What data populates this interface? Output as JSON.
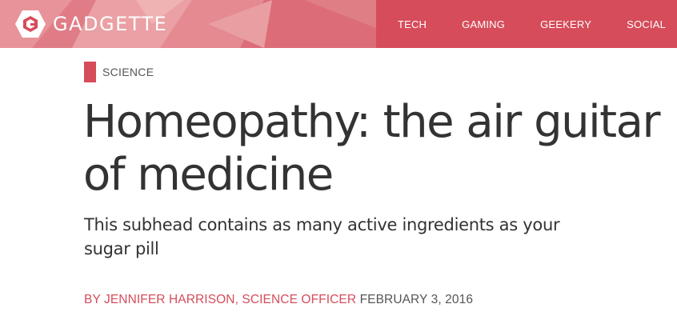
{
  "site": {
    "logo_text": "GADGETTE",
    "logo_icon": "gadgette-hexagon-logo-icon",
    "brand_color": "#d64c5a"
  },
  "nav": {
    "items": [
      {
        "label": "TECH"
      },
      {
        "label": "GAMING"
      },
      {
        "label": "GEEKERY"
      },
      {
        "label": "SOCIAL"
      }
    ]
  },
  "article": {
    "category": "SCIENCE",
    "headline": "Homeopathy: the air guitar of medicine",
    "subhead": "This subhead contains as many active ingredients as your sugar pill",
    "byline_author": "BY JENNIFER HARRISON, SCIENCE OFFICER",
    "byline_date": "FEBRUARY 3, 2016"
  }
}
